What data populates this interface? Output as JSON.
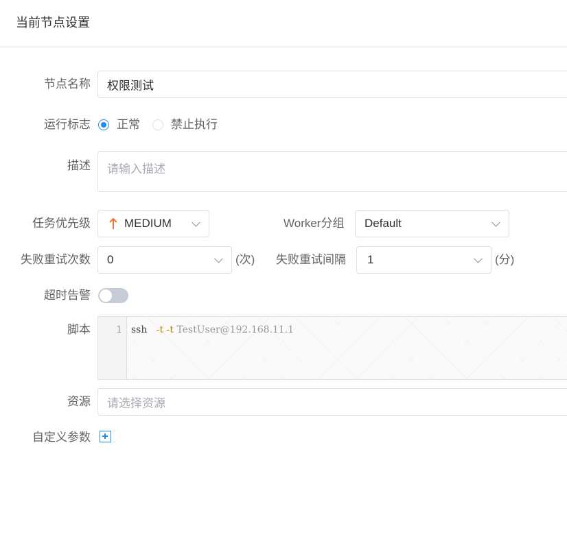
{
  "header": {
    "title": "当前节点设置"
  },
  "form": {
    "node_name": {
      "label": "节点名称",
      "value": "权限测试"
    },
    "run_flag": {
      "label": "运行标志",
      "options": [
        "正常",
        "禁止执行"
      ],
      "selected": "正常"
    },
    "description": {
      "label": "描述",
      "placeholder": "请输入描述"
    },
    "priority": {
      "label": "任务优先级",
      "value": "MEDIUM",
      "icon": "arrow-up-icon",
      "color": "#f5722c"
    },
    "worker_group": {
      "label": "Worker分组",
      "value": "Default"
    },
    "retry_times": {
      "label": "失败重试次数",
      "value": "0",
      "unit": "(次)"
    },
    "retry_interval": {
      "label": "失败重试间隔",
      "value": "1",
      "unit": "(分)"
    },
    "timeout_alarm": {
      "label": "超时告警",
      "enabled": false
    },
    "script": {
      "label": "脚本",
      "line_number": "1",
      "cmd": "ssh",
      "options": "-t -t",
      "target": "TestUser@192.168.11.1"
    },
    "resources": {
      "label": "资源",
      "placeholder": "请选择资源"
    },
    "custom_params": {
      "label": "自定义参数",
      "add_icon": "plus-square-icon"
    }
  },
  "colors": {
    "primary": "#1f8ceb",
    "border": "#dcdfe6",
    "label": "#606266"
  }
}
